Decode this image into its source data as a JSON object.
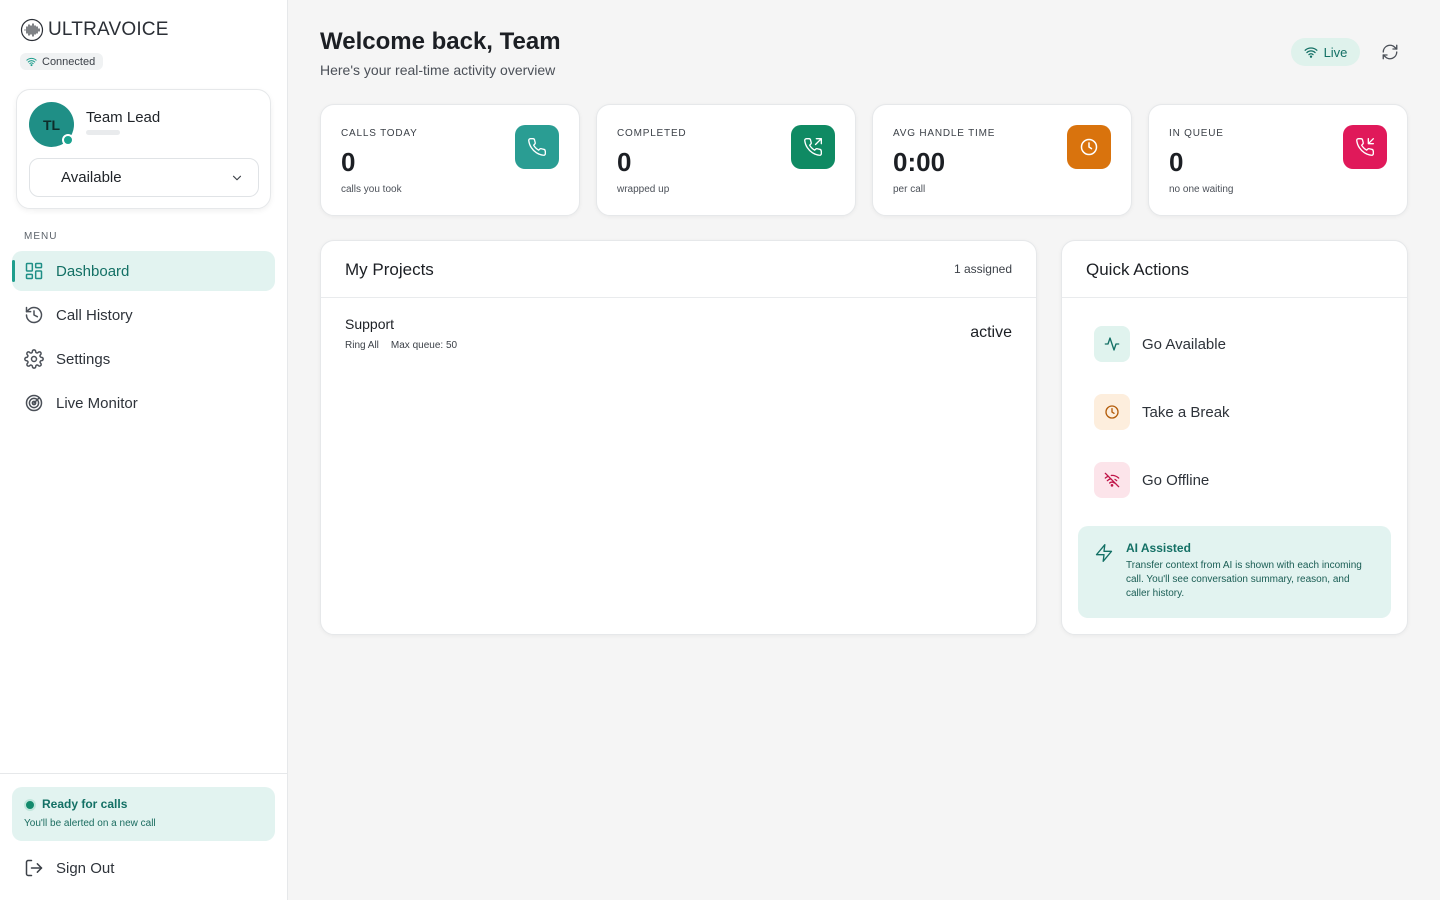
{
  "brand": {
    "name": "ULTRAVOICE",
    "connection": "Connected"
  },
  "user": {
    "initials": "TL",
    "name": "Team Lead",
    "status": "Available"
  },
  "menu": {
    "label": "MENU",
    "items": [
      {
        "label": "Dashboard",
        "icon": "grid-icon",
        "active": true
      },
      {
        "label": "Call History",
        "icon": "history-icon"
      },
      {
        "label": "Settings",
        "icon": "gear-icon"
      },
      {
        "label": "Live Monitor",
        "icon": "radar-icon"
      }
    ]
  },
  "footer": {
    "ready_title": "Ready for calls",
    "ready_sub": "You'll be alerted on a new call",
    "signout": "Sign Out"
  },
  "header": {
    "title": "Welcome back, Team",
    "subtitle": "Here's your real-time activity overview",
    "live": "Live"
  },
  "stats": [
    {
      "label": "CALLS TODAY",
      "value": "0",
      "note": "calls you took",
      "icon": "phone-icon",
      "color": "#2a9d93"
    },
    {
      "label": "COMPLETED",
      "value": "0",
      "note": "wrapped up",
      "icon": "phone-outgoing-icon",
      "color": "#0f8a63"
    },
    {
      "label": "AVG HANDLE TIME",
      "value": "0:00",
      "note": "per call",
      "icon": "clock-icon",
      "color": "#d9730d"
    },
    {
      "label": "IN QUEUE",
      "value": "0",
      "note": "no one waiting",
      "icon": "phone-incoming-icon",
      "color": "#e0195a"
    }
  ],
  "projects": {
    "title": "My Projects",
    "count": "1 assigned",
    "items": [
      {
        "name": "Support",
        "strategy": "Ring All",
        "queue": "Max queue: 50",
        "status": "active"
      }
    ]
  },
  "quick_actions": {
    "title": "Quick Actions",
    "items": [
      {
        "label": "Go Available",
        "icon": "activity-icon"
      },
      {
        "label": "Take a Break",
        "icon": "clock-icon"
      },
      {
        "label": "Go Offline",
        "icon": "wifi-off-icon"
      }
    ],
    "ai": {
      "title": "AI Assisted",
      "text": "Transfer context from AI is shown with each incoming call. You'll see conversation summary, reason, and caller history."
    }
  }
}
